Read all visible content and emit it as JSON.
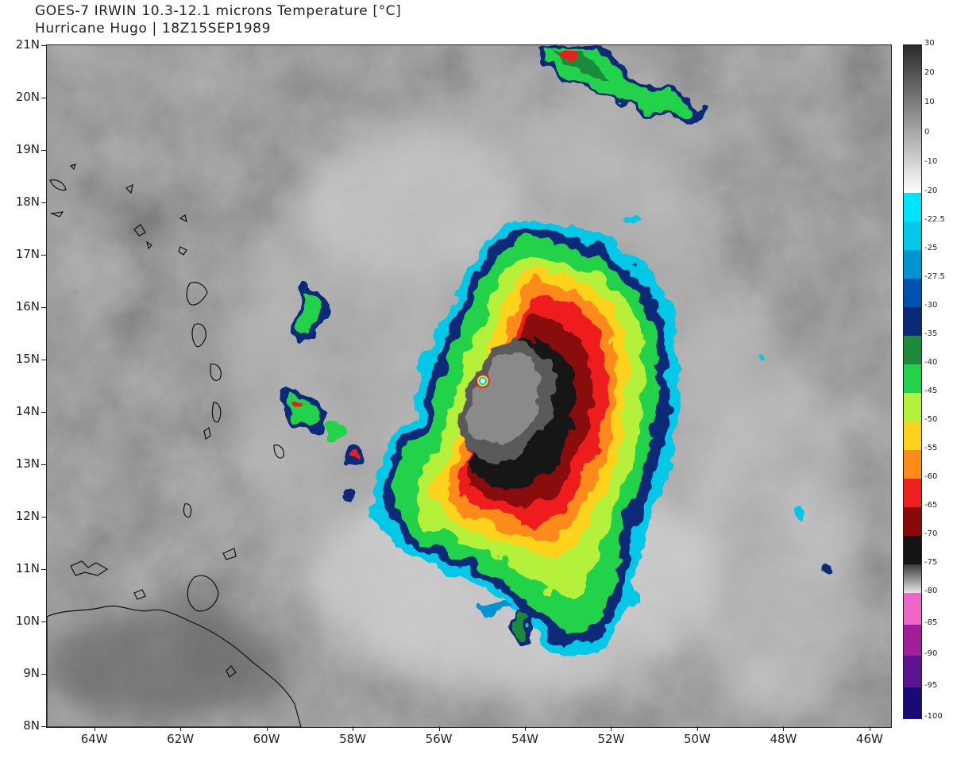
{
  "header": {
    "title": "GOES-7 IRWIN 10.3-12.1 microns Temperature [°C]",
    "subtitle": "Hurricane Hugo | 18Z15SEP1989"
  },
  "map": {
    "lat_labels": [
      "21N",
      "20N",
      "19N",
      "18N",
      "17N",
      "16N",
      "15N",
      "14N",
      "13N",
      "12N",
      "11N",
      "10N",
      "9N",
      "8N"
    ],
    "lon_labels": [
      "64W",
      "62W",
      "60W",
      "58W",
      "56W",
      "54W",
      "52W",
      "50W",
      "48W",
      "46W"
    ],
    "lat_range": [
      8,
      21
    ],
    "lon_range": [
      -65.1,
      -45.5
    ],
    "storm_name": "Hugo",
    "eye_position": {
      "lon": -54.7,
      "lat": 14.7
    }
  },
  "colorbar": {
    "unit": "°C",
    "labels": [
      "30",
      "20",
      "10",
      "0",
      "-10",
      "-20",
      "-22.5",
      "-25",
      "-27.5",
      "-30",
      "-35",
      "-40",
      "-45",
      "-50",
      "-55",
      "-60",
      "-65",
      "-70",
      "-75",
      "-80",
      "-85",
      "-90",
      "-95",
      "-100"
    ],
    "segments": [
      {
        "from": 30,
        "to": -20,
        "color_top": "#2a2a2a",
        "color_bottom": "#ffffff"
      },
      {
        "from": -20,
        "to": -22.5,
        "color": "#00e5ff"
      },
      {
        "from": -22.5,
        "to": -25,
        "color": "#00c8e6"
      },
      {
        "from": -25,
        "to": -27.5,
        "color": "#0095d0"
      },
      {
        "from": -27.5,
        "to": -30,
        "color": "#0050b0"
      },
      {
        "from": -30,
        "to": -35,
        "color": "#0a2a78"
      },
      {
        "from": -35,
        "to": -40,
        "color": "#1f8a3a"
      },
      {
        "from": -40,
        "to": -45,
        "color": "#22d24a"
      },
      {
        "from": -45,
        "to": -50,
        "color": "#b5f03a"
      },
      {
        "from": -50,
        "to": -55,
        "color": "#ffd21e"
      },
      {
        "from": -55,
        "to": -60,
        "color": "#ff8a1a"
      },
      {
        "from": -60,
        "to": -65,
        "color": "#ee1f1f"
      },
      {
        "from": -65,
        "to": -70,
        "color": "#8a0a0a"
      },
      {
        "from": -70,
        "to": -75,
        "color": "#141414"
      },
      {
        "from": -75,
        "to": -80,
        "color_top": "#3a3a3a",
        "color_bottom": "#e6e6e6"
      },
      {
        "from": -80,
        "to": -85,
        "color": "#ee66c8"
      },
      {
        "from": -85,
        "to": -90,
        "color": "#a0209a"
      },
      {
        "from": -90,
        "to": -95,
        "color": "#5a1490"
      },
      {
        "from": -95,
        "to": -100,
        "color": "#1a0a78"
      }
    ]
  }
}
